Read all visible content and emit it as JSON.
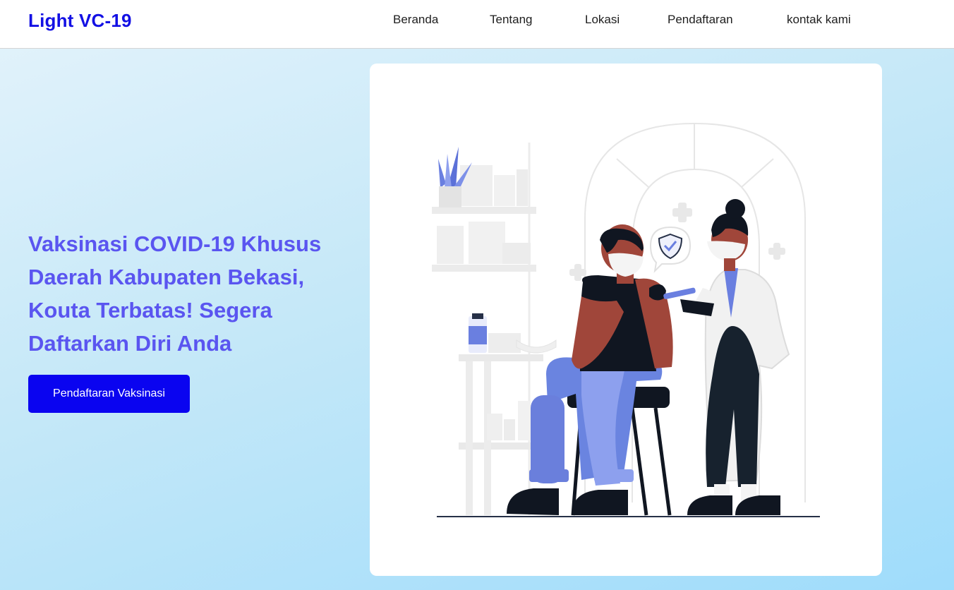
{
  "header": {
    "brand": "Light VC-19",
    "nav": [
      {
        "label": "Beranda"
      },
      {
        "label": "Tentang"
      },
      {
        "label": "Lokasi"
      },
      {
        "label": "Pendaftaran"
      },
      {
        "label": "kontak kami"
      }
    ]
  },
  "hero": {
    "title": "Vaksinasi COVID-19 Khusus Daerah Kabupaten Bekasi, Kouta Terbatas! Segera Daftarkan Diri Anda",
    "cta_label": "Pendaftaran Vaksinasi"
  },
  "illustration": {
    "subject": "vaccination-illustration"
  },
  "colors": {
    "brand": "#1310e4",
    "hero_text": "#5a55f0",
    "cta_background": "#0a04f0",
    "accent_blue": "#6a7fe0",
    "skin": "#a0463a"
  }
}
